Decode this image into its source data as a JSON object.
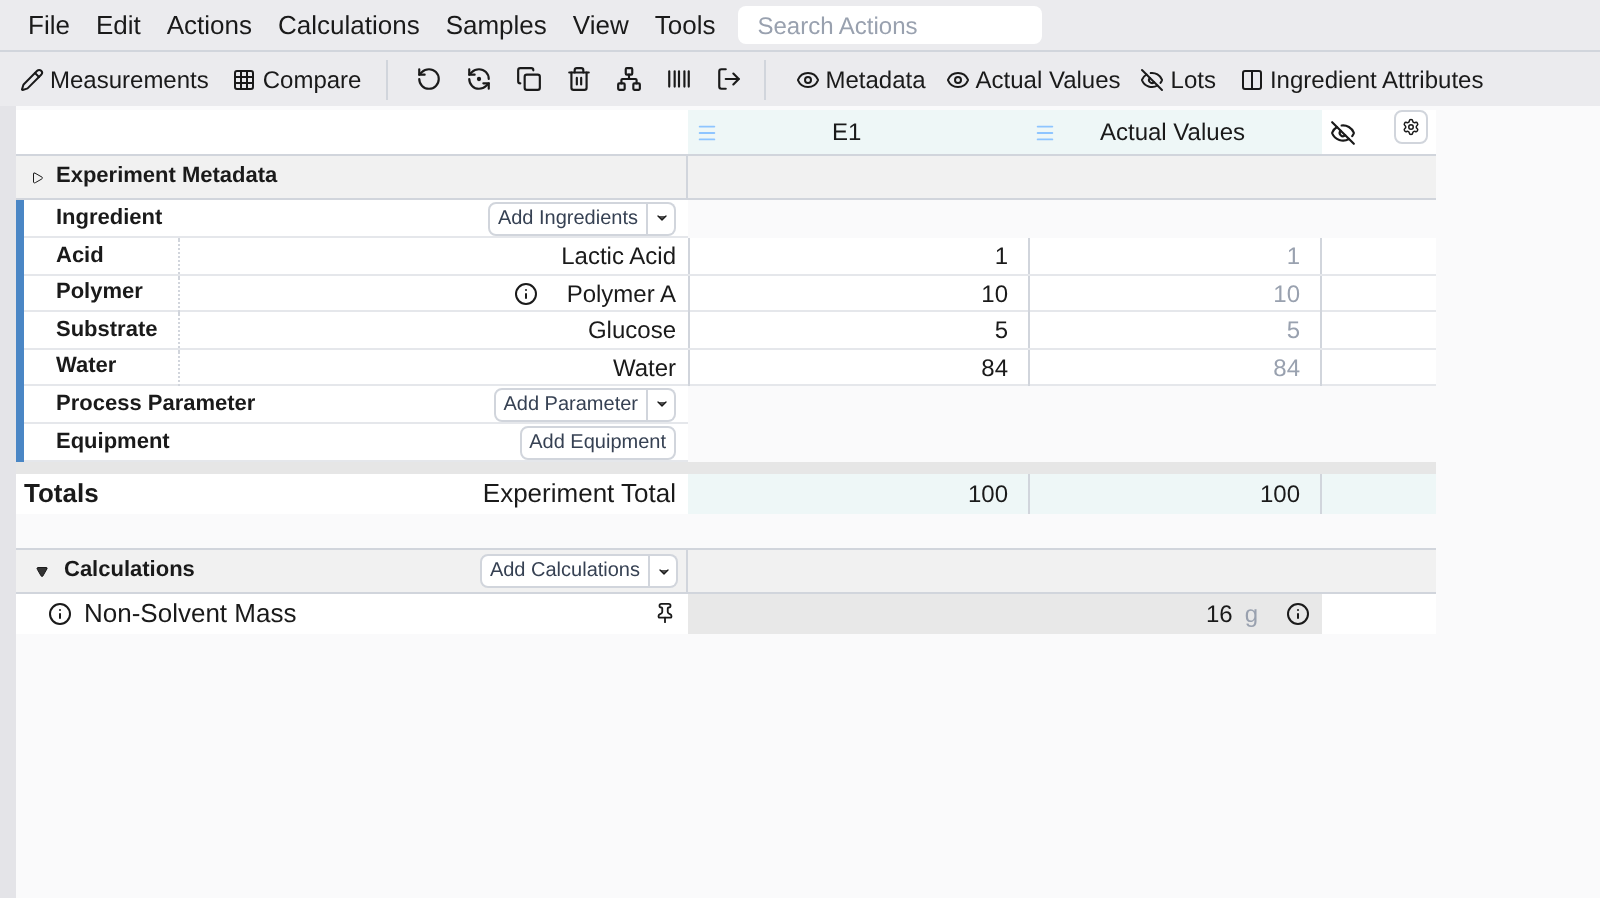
{
  "menu": [
    "File",
    "Edit",
    "Actions",
    "Calculations",
    "Samples",
    "View",
    "Tools"
  ],
  "search": {
    "placeholder": "Search Actions"
  },
  "toolbar": {
    "left": [
      "Measurements",
      "Compare"
    ],
    "toggles": [
      {
        "label": "Metadata",
        "on": true
      },
      {
        "label": "Actual Values",
        "on": true
      },
      {
        "label": "Lots",
        "on": false
      }
    ],
    "columns_button": "Ingredient Attributes"
  },
  "table": {
    "columns": [
      "E1",
      "Actual Values"
    ],
    "hidden_column_toggle": false,
    "metadata": {
      "label": "Experiment Metadata",
      "expanded": false
    },
    "groups": [
      {
        "label": "Ingredient",
        "button": "Add Ingredients",
        "dropdown": true,
        "rows": [
          {
            "category": "Acid",
            "name": "Lactic Acid",
            "info": false,
            "value": "1",
            "actual": "1"
          },
          {
            "category": "Polymer",
            "name": "Polymer A",
            "info": true,
            "value": "10",
            "actual": "10"
          },
          {
            "category": "Substrate",
            "name": "Glucose",
            "info": false,
            "value": "5",
            "actual": "5"
          },
          {
            "category": "Water",
            "name": "Water",
            "info": false,
            "value": "84",
            "actual": "84"
          }
        ]
      },
      {
        "label": "Process Parameter",
        "button": "Add Parameter",
        "dropdown": true
      },
      {
        "label": "Equipment",
        "button": "Add Equipment",
        "dropdown": false
      }
    ],
    "totals": {
      "label": "Totals",
      "name": "Experiment Total",
      "value": "100",
      "actual": "100"
    },
    "calculations": {
      "label": "Calculations",
      "expanded": true,
      "button": "Add Calculations",
      "rows": [
        {
          "name": "Non-Solvent Mass",
          "value": "16",
          "unit": "g"
        }
      ]
    }
  }
}
